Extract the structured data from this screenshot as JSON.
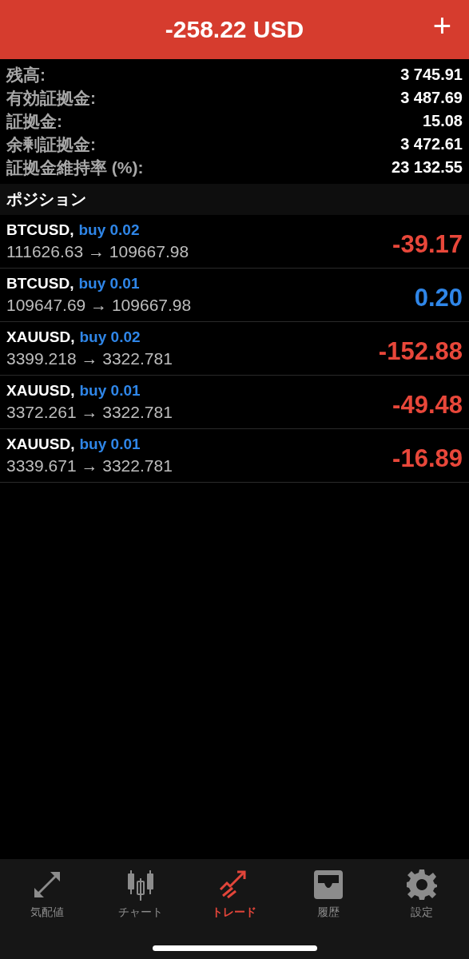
{
  "header": {
    "title": "-258.22 USD",
    "action": "+"
  },
  "summary": [
    {
      "label": "残高:",
      "value": "3 745.91"
    },
    {
      "label": "有効証拠金:",
      "value": "3 487.69"
    },
    {
      "label": "証拠金:",
      "value": "15.08"
    },
    {
      "label": "余剰証拠金:",
      "value": "3 472.61"
    },
    {
      "label": "証拠金維持率 (%):",
      "value": "23 132.55"
    }
  ],
  "section_title": "ポジション",
  "positions": [
    {
      "symbol": "BTCUSD,",
      "order": "buy 0.02",
      "prices": "111626.63 → 109667.98",
      "profit": "-39.17",
      "color": "#e8473a"
    },
    {
      "symbol": "BTCUSD,",
      "order": "buy 0.01",
      "prices": "109647.69 → 109667.98",
      "profit": "0.20",
      "color": "#2f86e8"
    },
    {
      "symbol": "XAUUSD,",
      "order": "buy 0.02",
      "prices": "3399.218 → 3322.781",
      "profit": "-152.88",
      "color": "#e8473a"
    },
    {
      "symbol": "XAUUSD,",
      "order": "buy 0.01",
      "prices": "3372.261 → 3322.781",
      "profit": "-49.48",
      "color": "#e8473a"
    },
    {
      "symbol": "XAUUSD,",
      "order": "buy 0.01",
      "prices": "3339.671 → 3322.781",
      "profit": "-16.89",
      "color": "#e8473a"
    }
  ],
  "tabs": [
    {
      "kind": "quotes",
      "label": "気配値",
      "selected": false
    },
    {
      "kind": "chart",
      "label": "チャート",
      "selected": false
    },
    {
      "kind": "trade",
      "label": "トレード",
      "selected": true
    },
    {
      "kind": "history",
      "label": "履歴",
      "selected": false
    },
    {
      "kind": "settings",
      "label": "設定",
      "selected": false
    }
  ]
}
